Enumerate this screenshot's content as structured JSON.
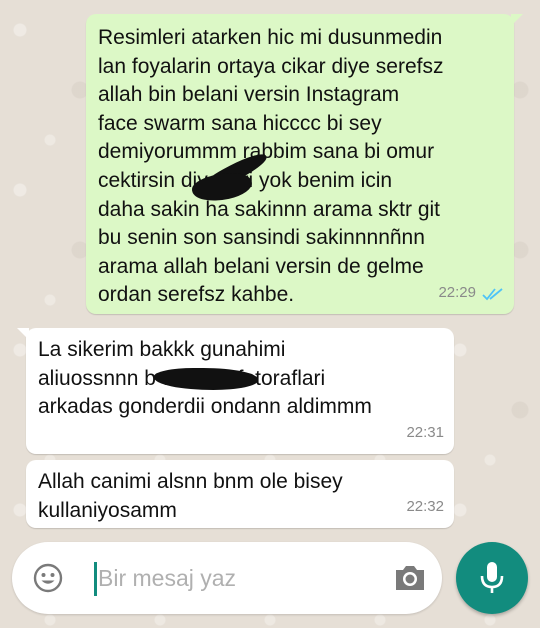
{
  "colors": {
    "outgoing_bubble": "#dcf8c6",
    "incoming_bubble": "#ffffff",
    "accent": "#128c7e",
    "read_ticks": "#4fc3f7"
  },
  "messages": [
    {
      "direction": "outgoing",
      "text": "Resimleri atarken hic mi dusunmedin\nlan foyalarin ortaya cikar diye serefsz\nallah bin belani versin Instagram\nface swarm  sana hicccc bi sey\ndemiyorummm  rabbim sana bi omur\ncektirsin  diye biri yok benim icin\ndaha sakin ha sakinnn arama sktr git\nbu senin son sansindi sakinnnnñnn\narama allah belani versin  de gelme\nordan serefsz kahbe.",
      "time": "22:29",
      "status_icon": "double-check-read-icon"
    },
    {
      "direction": "incoming",
      "text": "La sikerim bakkk gunahimi\naliuossnnn b        u bna o fotoraflari\narkadas gonderdii ondann aldimmm",
      "time": "22:31"
    },
    {
      "direction": "incoming",
      "text": "Allah canimi alsnn bnm ole bisey\nkullaniyosamm",
      "time": "22:32"
    }
  ],
  "composer": {
    "placeholder": "Bir mesaj yaz",
    "value": "",
    "emoji_icon": "emoji-icon",
    "camera_icon": "camera-icon",
    "send_icon": "microphone-icon"
  }
}
